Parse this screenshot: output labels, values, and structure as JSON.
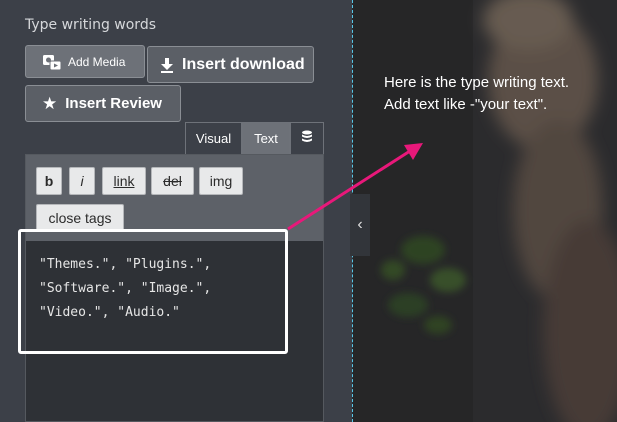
{
  "panel": {
    "title": "Type writing words"
  },
  "media_buttons": {
    "add_media": "Add Media",
    "insert_download": "Insert download",
    "insert_review": "Insert Review"
  },
  "tabs": {
    "visual": "Visual",
    "text": "Text",
    "active": "Text"
  },
  "quicktags": {
    "bold": "b",
    "italic": "i",
    "link": "link",
    "del": "del",
    "img": "img",
    "close_tags": "close tags"
  },
  "editor": {
    "lines": [
      "\"Themes.\", \"Plugins.\",",
      "\"Software.\", \"Image.\",",
      "\"Video.\", \"Audio.\""
    ]
  },
  "preview": {
    "line1": "Here is the type writing text.",
    "line2": "Add text like -\"your text\"."
  },
  "handle": {
    "glyph": "‹"
  },
  "colors": {
    "panel_bg": "#3c4048",
    "annotation_arrow": "#e8187a",
    "guide_line": "#58c8e8"
  },
  "icons": {
    "media": "camera-media-icon",
    "download": "download-icon",
    "review": "star-icon",
    "database": "database-icon",
    "collapse": "chevron-left-icon"
  }
}
